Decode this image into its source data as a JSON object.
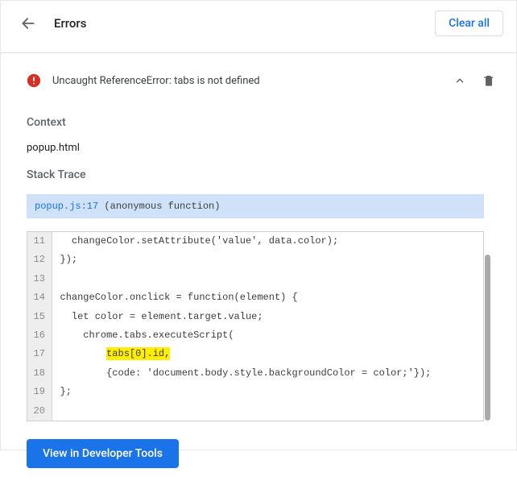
{
  "header": {
    "title": "Errors",
    "clear_all": "Clear all"
  },
  "error": {
    "title": "Uncaught ReferenceError: tabs is not defined"
  },
  "sections": {
    "context_label": "Context",
    "context_value": "popup.html",
    "stack_label": "Stack Trace"
  },
  "stack_frame": {
    "location": "popup.js:17",
    "name": " (anonymous function)"
  },
  "code": {
    "lines": [
      {
        "n": "11",
        "t": "  changeColor.setAttribute('value', data.color);"
      },
      {
        "n": "12",
        "t": "});"
      },
      {
        "n": "13",
        "t": ""
      },
      {
        "n": "14",
        "t": "changeColor.onclick = function(element) {"
      },
      {
        "n": "15",
        "t": "  let color = element.target.value;"
      },
      {
        "n": "16",
        "t": "    chrome.tabs.executeScript("
      },
      {
        "n": "17",
        "t": "        ",
        "hl": "tabs[0].id,"
      },
      {
        "n": "18",
        "t": "        {code: 'document.body.style.backgroundColor = color;'});"
      },
      {
        "n": "19",
        "t": "};"
      },
      {
        "n": "20",
        "t": ""
      }
    ]
  },
  "buttons": {
    "view_devtools": "View in Developer Tools"
  }
}
